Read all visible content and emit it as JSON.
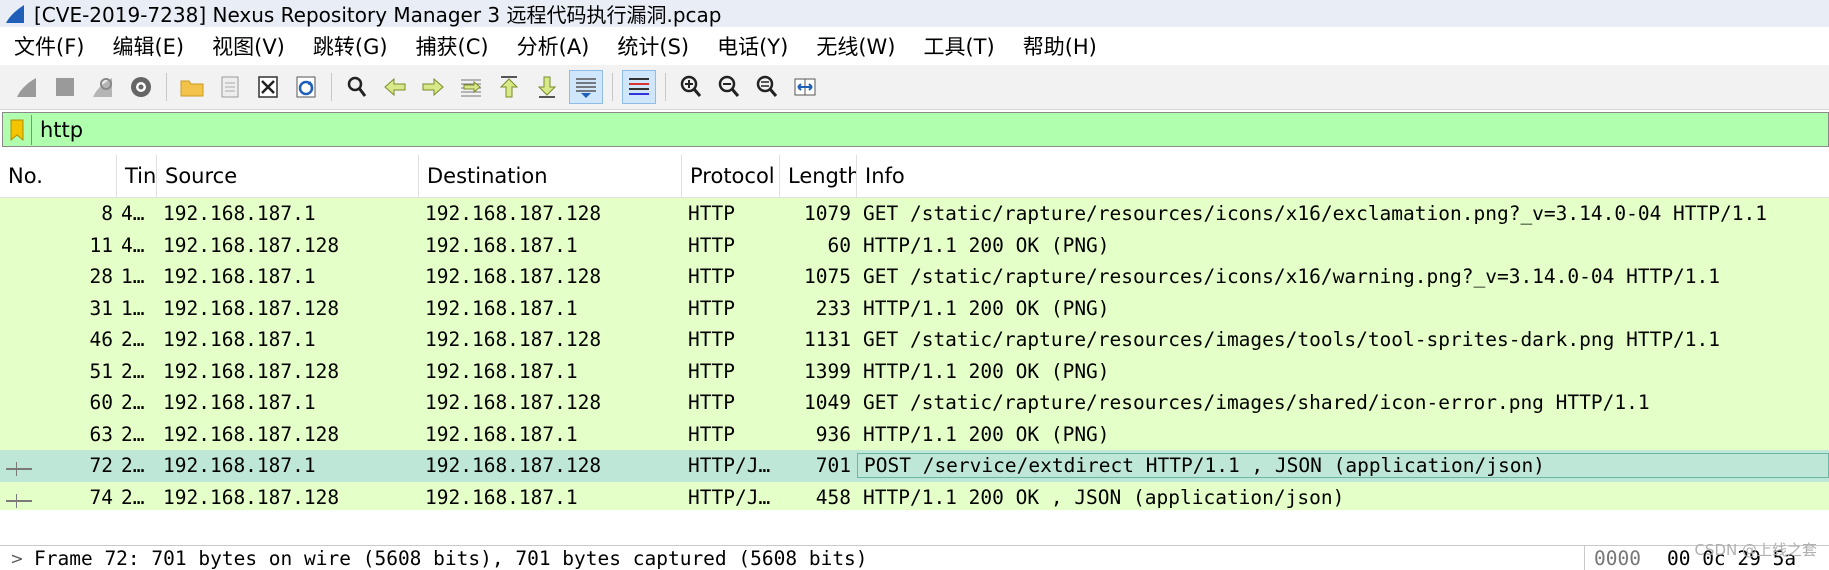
{
  "window": {
    "title": "[CVE-2019-7238] Nexus Repository Manager 3 远程代码执行漏洞.pcap"
  },
  "menu": [
    "文件(F)",
    "编辑(E)",
    "视图(V)",
    "跳转(G)",
    "捕获(C)",
    "分析(A)",
    "统计(S)",
    "电话(Y)",
    "无线(W)",
    "工具(T)",
    "帮助(H)"
  ],
  "filter": {
    "value": "http"
  },
  "columns": [
    "No.",
    "Tin",
    "Source",
    "Destination",
    "Protocol",
    "Length",
    "Info"
  ],
  "packets": [
    {
      "no": "8",
      "time": "4…",
      "src": "192.168.187.1",
      "dst": "192.168.187.128",
      "proto": "HTTP",
      "len": "1079",
      "info": "GET /static/rapture/resources/icons/x16/exclamation.png?_v=3.14.0-04 HTTP/1.1"
    },
    {
      "no": "11",
      "time": "4…",
      "src": "192.168.187.128",
      "dst": "192.168.187.1",
      "proto": "HTTP",
      "len": "60",
      "info": "HTTP/1.1 200 OK  (PNG)"
    },
    {
      "no": "28",
      "time": "1…",
      "src": "192.168.187.1",
      "dst": "192.168.187.128",
      "proto": "HTTP",
      "len": "1075",
      "info": "GET /static/rapture/resources/icons/x16/warning.png?_v=3.14.0-04 HTTP/1.1"
    },
    {
      "no": "31",
      "time": "1…",
      "src": "192.168.187.128",
      "dst": "192.168.187.1",
      "proto": "HTTP",
      "len": "233",
      "info": "HTTP/1.1 200 OK  (PNG)"
    },
    {
      "no": "46",
      "time": "2…",
      "src": "192.168.187.1",
      "dst": "192.168.187.128",
      "proto": "HTTP",
      "len": "1131",
      "info": "GET /static/rapture/resources/images/tools/tool-sprites-dark.png HTTP/1.1"
    },
    {
      "no": "51",
      "time": "2…",
      "src": "192.168.187.128",
      "dst": "192.168.187.1",
      "proto": "HTTP",
      "len": "1399",
      "info": "HTTP/1.1 200 OK  (PNG)"
    },
    {
      "no": "60",
      "time": "2…",
      "src": "192.168.187.1",
      "dst": "192.168.187.128",
      "proto": "HTTP",
      "len": "1049",
      "info": "GET /static/rapture/resources/images/shared/icon-error.png HTTP/1.1"
    },
    {
      "no": "63",
      "time": "2…",
      "src": "192.168.187.128",
      "dst": "192.168.187.1",
      "proto": "HTTP",
      "len": "936",
      "info": "HTTP/1.1 200 OK  (PNG)"
    },
    {
      "no": "72",
      "time": "2…",
      "src": "192.168.187.1",
      "dst": "192.168.187.128",
      "proto": "HTTP/J…",
      "len": "701",
      "info": "POST /service/extdirect HTTP/1.1 , JSON (application/json)"
    },
    {
      "no": "74",
      "time": "2…",
      "src": "192.168.187.128",
      "dst": "192.168.187.1",
      "proto": "HTTP/J…",
      "len": "458",
      "info": "HTTP/1.1 200 OK , JSON (application/json)"
    }
  ],
  "detail": {
    "summary": "Frame 72: 701 bytes on wire (5608 bits), 701 bytes captured (5608 bits)",
    "hex_offset": "0000",
    "hex_bytes": "00 0c 29 5a"
  },
  "watermark": "CSDN @上线之套",
  "colors": {
    "filter_ok": "#afffaf",
    "row_http": "#e4ffc7",
    "row_selected": "#bfe7d7"
  }
}
